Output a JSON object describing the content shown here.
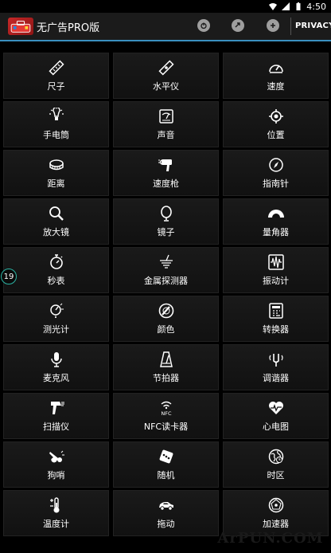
{
  "status_bar": {
    "time": "4:50",
    "icons": [
      "wifi-icon",
      "signal-icon",
      "battery-icon"
    ]
  },
  "action_bar": {
    "title": "无广告PRO版",
    "logo_icon": "toolbox-icon",
    "buttons": [
      "power-icon",
      "share-icon",
      "add-icon"
    ],
    "privacy_label": "PRIVACY",
    "accent_color": "#3a8fbf"
  },
  "tools": [
    {
      "label": "尺子",
      "icon": "ruler-icon"
    },
    {
      "label": "水平仪",
      "icon": "level-icon"
    },
    {
      "label": "速度",
      "icon": "speedometer-icon"
    },
    {
      "label": "手电筒",
      "icon": "flashlight-icon"
    },
    {
      "label": "声音",
      "icon": "sound-meter-icon"
    },
    {
      "label": "位置",
      "icon": "location-icon"
    },
    {
      "label": "距离",
      "icon": "distance-icon"
    },
    {
      "label": "速度枪",
      "icon": "speed-gun-icon"
    },
    {
      "label": "指南针",
      "icon": "compass-icon"
    },
    {
      "label": "放大镜",
      "icon": "magnifier-icon"
    },
    {
      "label": "镜子",
      "icon": "mirror-icon"
    },
    {
      "label": "量角器",
      "icon": "protractor-icon"
    },
    {
      "label": "秒表",
      "icon": "stopwatch-icon"
    },
    {
      "label": "金属探测器",
      "icon": "metal-detector-icon"
    },
    {
      "label": "振动计",
      "icon": "vibrometer-icon"
    },
    {
      "label": "测光计",
      "icon": "light-meter-icon"
    },
    {
      "label": "颜色",
      "icon": "color-icon"
    },
    {
      "label": "转换器",
      "icon": "converter-icon"
    },
    {
      "label": "麦克风",
      "icon": "microphone-icon"
    },
    {
      "label": "节拍器",
      "icon": "metronome-icon"
    },
    {
      "label": "调谐器",
      "icon": "tuner-icon"
    },
    {
      "label": "扫描仪",
      "icon": "scanner-icon"
    },
    {
      "label": "NFC读卡器",
      "icon": "nfc-icon"
    },
    {
      "label": "心电图",
      "icon": "heart-rate-icon"
    },
    {
      "label": "狗哨",
      "icon": "dog-whistle-icon"
    },
    {
      "label": "随机",
      "icon": "dice-icon"
    },
    {
      "label": "时区",
      "icon": "timezone-icon"
    },
    {
      "label": "温度计",
      "icon": "thermometer-icon"
    },
    {
      "label": "拖动",
      "icon": "car-icon"
    },
    {
      "label": "加速器",
      "icon": "accelerometer-icon"
    }
  ],
  "side_badge": "19",
  "watermark": "ArPUN.COM"
}
